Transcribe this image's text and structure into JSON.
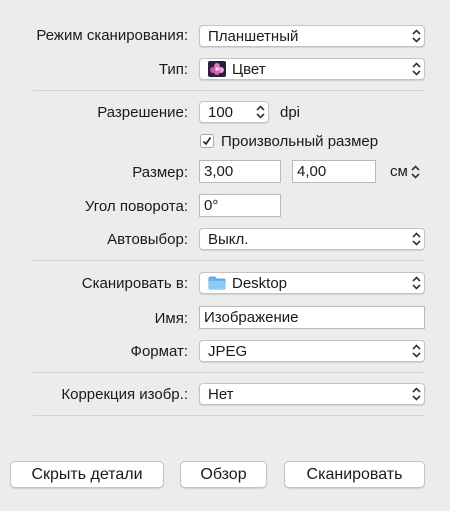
{
  "scan_mode": {
    "label": "Режим сканирования:",
    "value": "Планшетный"
  },
  "type": {
    "label": "Тип:",
    "value": "Цвет",
    "icon": "color-flower-icon"
  },
  "resolution": {
    "label": "Разрешение:",
    "value": "100",
    "unit": "dpi"
  },
  "custom_size": {
    "label": "Произвольный размер",
    "checked": true
  },
  "size": {
    "label": "Размер:",
    "width": "3,00",
    "height": "4,00",
    "unit": "см"
  },
  "rotation": {
    "label": "Угол поворота:",
    "value": "0°"
  },
  "auto_select": {
    "label": "Автовыбор:",
    "value": "Выкл."
  },
  "scan_to": {
    "label": "Сканировать в:",
    "value": "Desktop",
    "icon": "folder-icon"
  },
  "name": {
    "label": "Имя:",
    "value": "Изображение"
  },
  "format": {
    "label": "Формат:",
    "value": "JPEG"
  },
  "correction": {
    "label": "Коррекция изобр.:",
    "value": "Нет"
  },
  "buttons": {
    "hide_details": "Скрыть детали",
    "browse": "Обзор",
    "scan": "Сканировать"
  }
}
